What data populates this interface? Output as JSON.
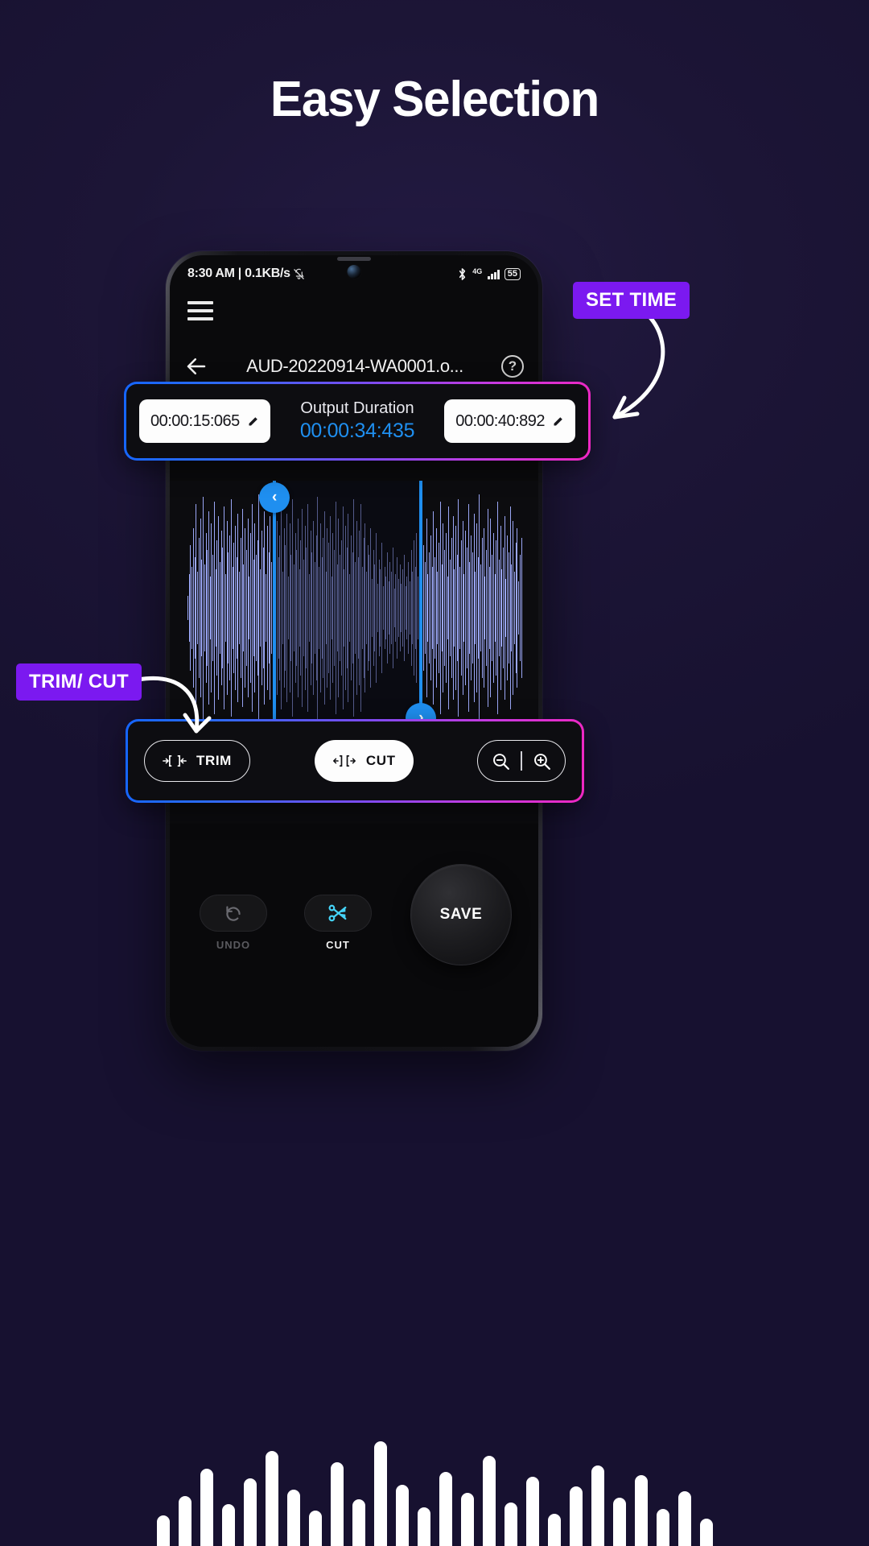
{
  "headline": "Easy Selection",
  "colors": {
    "background": "#1c1536",
    "accent_purple": "#7b19f0",
    "accent_blue": "#1f8ff0",
    "waveform": "#9aa6f5",
    "gradient_start": "#1565ff",
    "gradient_end": "#ef27c2",
    "cut_icon_cyan": "#45d3f7"
  },
  "phone": {
    "status_bar": {
      "time_and_net": "8:30 AM | 0.1KB/s",
      "mute_icon": "bell-slash-icon",
      "bluetooth_icon": "bluetooth-icon",
      "network_type": "4G",
      "battery_level": "55"
    },
    "menu_icon": "hamburger-menu-icon",
    "app_bar": {
      "back_icon": "back-arrow-icon",
      "title": "AUD-20220914-WA0001.o...",
      "help_icon": "help-circle-icon",
      "help_label": "?"
    },
    "time_panel": {
      "start_time": "00:00:15:065",
      "start_edit_icon": "pencil-icon",
      "duration_label": "Output Duration",
      "duration_value": "00:00:34:435",
      "end_time": "00:00:40:892",
      "end_edit_icon": "pencil-icon"
    },
    "waveform": {
      "left_handle_icon": "chevron-left-icon",
      "left_handle_glyph": "‹",
      "right_handle_icon": "chevron-right-icon",
      "right_handle_glyph": "›"
    },
    "toolbar": {
      "trim_label": "TRIM",
      "trim_icon": "trim-brackets-icon",
      "trim_glyph": "→[ ]←",
      "cut_label": "CUT",
      "cut_icon": "cut-brackets-icon",
      "cut_glyph": "←][→",
      "zoom_out_icon": "zoom-out-icon",
      "zoom_in_icon": "zoom-in-icon"
    },
    "action_bar": {
      "undo_label": "UNDO",
      "undo_icon": "undo-arrow-icon",
      "cut_label": "CUT",
      "cut_icon": "scissors-icon",
      "save_label": "SAVE"
    }
  },
  "callouts": {
    "set_time": "SET TIME",
    "trim_cut": "TRIM/ CUT"
  },
  "chart_data": {
    "type": "area",
    "title": "Audio waveform",
    "waveform_amplitudes": [
      0.1,
      0.28,
      0.52,
      0.34,
      0.66,
      0.42,
      0.86,
      0.3,
      0.58,
      0.74,
      0.4,
      0.92,
      0.36,
      0.62,
      0.48,
      0.8,
      0.26,
      0.7,
      0.44,
      0.88,
      0.32,
      0.56,
      0.76,
      0.38,
      0.64,
      0.5,
      0.84,
      0.28,
      0.72,
      0.46,
      0.6,
      0.9,
      0.34,
      0.54,
      0.68,
      0.42,
      0.78,
      0.3,
      0.58,
      0.82,
      0.36,
      0.66,
      0.48,
      0.74,
      0.26,
      0.62,
      0.86,
      0.4,
      0.7,
      0.44,
      0.56,
      0.94,
      0.32,
      0.64,
      0.5,
      0.8,
      0.28,
      0.68,
      0.46,
      0.76,
      0.38,
      0.58,
      0.88,
      0.34,
      0.72,
      0.42,
      0.6,
      0.84,
      0.3,
      0.66,
      0.52,
      0.78,
      0.26,
      0.7,
      0.44,
      0.9,
      0.36,
      0.62,
      0.48,
      0.74,
      0.32,
      0.56,
      0.82,
      0.4,
      0.68,
      0.5,
      0.86,
      0.28,
      0.64,
      0.46,
      0.72,
      0.38,
      0.6,
      0.92,
      0.34,
      0.7,
      0.42,
      0.58,
      0.8,
      0.3,
      0.66,
      0.54,
      0.76,
      0.26,
      0.62,
      0.48,
      0.88,
      0.36,
      0.74,
      0.44,
      0.56,
      0.84,
      0.32,
      0.68,
      0.5,
      0.78,
      0.28,
      0.6,
      0.46,
      0.9,
      0.38,
      0.72,
      0.42,
      0.64,
      0.86,
      0.34,
      0.58,
      0.7,
      0.3,
      0.52,
      0.44,
      0.66,
      0.24,
      0.48,
      0.36,
      0.62,
      0.2,
      0.4,
      0.32,
      0.54,
      0.18,
      0.34,
      0.26,
      0.46,
      0.22,
      0.38,
      0.3,
      0.5,
      0.16,
      0.28,
      0.42,
      0.24,
      0.36,
      0.2,
      0.32,
      0.44,
      0.18,
      0.26,
      0.38,
      0.22,
      0.48,
      0.3,
      0.56,
      0.34,
      0.62,
      0.26,
      0.44,
      0.68,
      0.32,
      0.52,
      0.38,
      0.74,
      0.28,
      0.46,
      0.6,
      0.34,
      0.8,
      0.42,
      0.66,
      0.3,
      0.54,
      0.88,
      0.36,
      0.7,
      0.48,
      0.62,
      0.26,
      0.84,
      0.4,
      0.58,
      0.76,
      0.32,
      0.68,
      0.44,
      0.9,
      0.34,
      0.56,
      0.72,
      0.28,
      0.64,
      0.5,
      0.86,
      0.38,
      0.6,
      0.46,
      0.78,
      0.3,
      0.7,
      0.42,
      0.94,
      0.36,
      0.58,
      0.66,
      0.26,
      0.48,
      0.82,
      0.34,
      0.74,
      0.44,
      0.62,
      0.28,
      0.56,
      0.88,
      0.4,
      0.68,
      0.32,
      0.5,
      0.76,
      0.24,
      0.6,
      0.46,
      0.84,
      0.36,
      0.72,
      0.3,
      0.54,
      0.66,
      0.22,
      0.44,
      0.58
    ],
    "selection_start_fraction": 0.255,
    "selection_end_fraction": 0.685
  },
  "bottom_decor": {
    "heights": [
      38,
      62,
      96,
      52,
      84,
      118,
      70,
      44,
      104,
      58,
      130,
      76,
      48,
      92,
      66,
      112,
      54,
      86,
      40,
      74,
      100,
      60,
      88,
      46,
      68,
      34
    ]
  }
}
